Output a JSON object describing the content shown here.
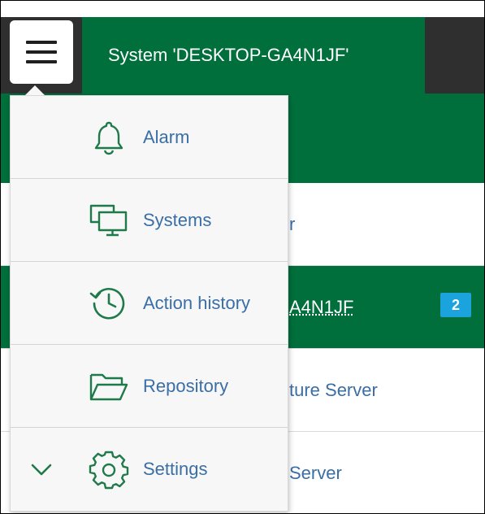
{
  "header": {
    "system_title": "System 'DESKTOP-GA4N1JF'"
  },
  "background_list": [
    {
      "text": "r",
      "active": false
    },
    {
      "text": "A4N1JF",
      "active": true,
      "badge": "2"
    },
    {
      "text": "ture Server",
      "active": false
    },
    {
      "text": "Server",
      "active": false
    }
  ],
  "menu": {
    "items": [
      {
        "label": "Alarm",
        "icon": "bell-icon"
      },
      {
        "label": "Systems",
        "icon": "monitors-icon"
      },
      {
        "label": "Action history",
        "icon": "history-clock-icon"
      },
      {
        "label": "Repository",
        "icon": "folder-icon"
      },
      {
        "label": "Settings",
        "icon": "gear-icon"
      }
    ]
  },
  "colors": {
    "brand_green": "#006f3c",
    "dark_bar": "#2f2f2f",
    "link_blue": "#3a6ea5",
    "badge_blue": "#1aa3dc"
  }
}
